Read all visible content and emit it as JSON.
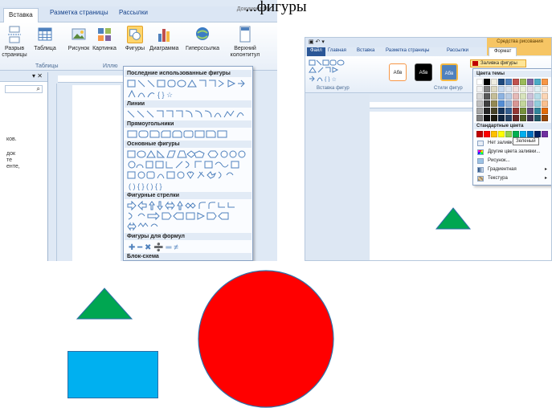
{
  "heading": {
    "text": "...фигуры"
  },
  "left_window": {
    "title_fragment": "Документ Micr",
    "tabs": [
      "Вставка",
      "Разметка страницы",
      "Рассылки"
    ],
    "ribbon_buttons": [
      {
        "label": "Разрыв страницы",
        "icon": "page-break-icon"
      },
      {
        "label": "Таблица",
        "icon": "table-icon"
      },
      {
        "label": "Рисунок",
        "icon": "picture-icon"
      },
      {
        "label": "Картинка",
        "icon": "clipart-icon"
      },
      {
        "label": "Фигуры",
        "icon": "shapes-icon",
        "selected": true
      },
      {
        "label": "Диаграмма",
        "icon": "chart-icon"
      },
      {
        "label": "Гиперссылка",
        "icon": "hyperlink-icon"
      },
      {
        "label": "Верхний колонтитул",
        "icon": "header-icon"
      }
    ],
    "group_labels": [
      "Таблицы",
      "Иллю"
    ],
    "nav_text": [
      "ков.",
      "док",
      "те",
      "енте,"
    ],
    "shapes_gallery": {
      "sections": [
        "Последние использованные фигуры",
        "Линии",
        "Прямоугольники",
        "Основные фигуры",
        "Фигурные стрелки",
        "Фигуры для формул",
        "Блок-схема"
      ]
    }
  },
  "right_window": {
    "contextual_tab": "Средства рисования",
    "tabs": [
      "Файл",
      "Главная",
      "Вставка",
      "Разметка страницы",
      "Рассылки",
      "Формат"
    ],
    "groups": [
      "Вставка фигур",
      "Стили фигур"
    ],
    "style_buttons": [
      "Абв",
      "Абв",
      "Абв"
    ],
    "fill_button": "Заливка фигуры",
    "palette": {
      "theme_heading": "Цвета темы",
      "standard_heading": "Стандартные цвета",
      "theme_colors": [
        "#ffffff",
        "#000000",
        "#eeece1",
        "#1f497d",
        "#4f81bd",
        "#c0504d",
        "#9bbb59",
        "#8064a2",
        "#4bacc6",
        "#f79646",
        "#f2f2f2",
        "#7f7f7f",
        "#ddd9c3",
        "#c6d9f0",
        "#dbe5f1",
        "#f2dcdb",
        "#ebf1dd",
        "#e5e0ec",
        "#dbeef3",
        "#fdeada",
        "#d8d8d8",
        "#595959",
        "#c4bd97",
        "#8db3e2",
        "#b8cce4",
        "#e5b9b7",
        "#d7e3bc",
        "#ccc1d9",
        "#b7dde8",
        "#fbd5b5",
        "#bfbfbf",
        "#3f3f3f",
        "#938953",
        "#548dd4",
        "#95b3d7",
        "#d99694",
        "#c3d69b",
        "#b2a2c7",
        "#92cddc",
        "#fac08f",
        "#a5a5a5",
        "#262626",
        "#494429",
        "#17365d",
        "#366092",
        "#953734",
        "#76923c",
        "#5f497a",
        "#31859b",
        "#e36c09",
        "#7f7f7f",
        "#0c0c0c",
        "#1d1b10",
        "#0f243e",
        "#244061",
        "#632423",
        "#4f6128",
        "#3f3151",
        "#205867",
        "#974806"
      ],
      "standard_colors": [
        "#c00000",
        "#ff0000",
        "#ffc000",
        "#ffff00",
        "#92d050",
        "#00b050",
        "#00b0f0",
        "#0070c0",
        "#002060",
        "#7030a0"
      ],
      "items": [
        {
          "label": "Нет заливки",
          "icon": "no-fill-icon"
        },
        {
          "label": "Другие цвета заливки...",
          "icon": "more-colors-icon"
        },
        {
          "label": "Рисунок...",
          "icon": "picture-fill-icon"
        },
        {
          "label": "Градиентная",
          "icon": "gradient-icon",
          "submenu": true
        },
        {
          "label": "Текстура",
          "icon": "texture-icon",
          "submenu": true
        }
      ],
      "tooltip": "Зеленый"
    }
  },
  "drawings": {
    "triangle_color": "#00a651",
    "circle_color": "#ff0000",
    "rectangle_color": "#00b0f0",
    "outline_color": "#2e6fa7"
  }
}
